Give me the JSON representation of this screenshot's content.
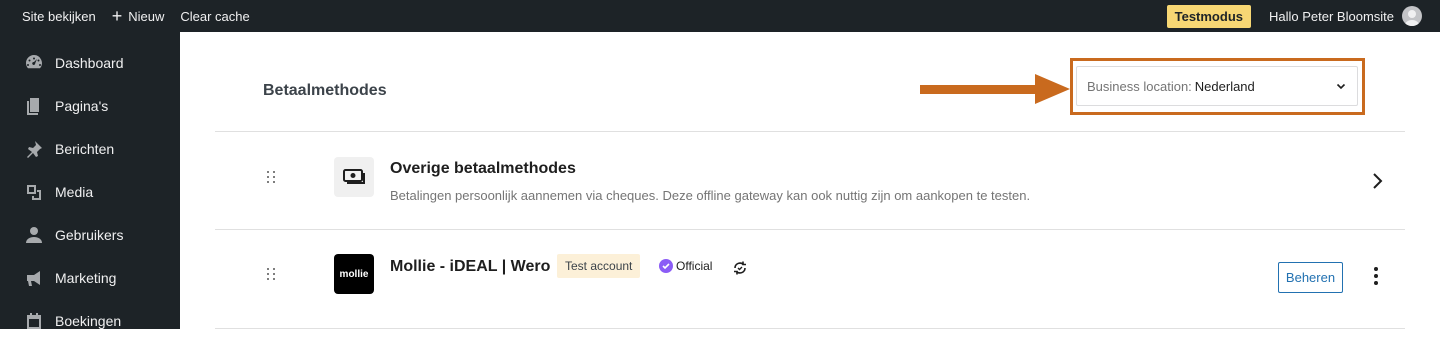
{
  "adminbar": {
    "site_link": "Site bekijken",
    "new_label": "Nieuw",
    "clear_cache": "Clear cache",
    "test_mode": "Testmodus",
    "greeting": "Hallo Peter Bloomsite"
  },
  "sidebar": {
    "items": [
      {
        "label": "Dashboard",
        "icon": "dashboard-icon"
      },
      {
        "label": "Pagina's",
        "icon": "pages-icon"
      },
      {
        "label": "Berichten",
        "icon": "pin-icon"
      },
      {
        "label": "Media",
        "icon": "media-icon"
      },
      {
        "label": "Gebruikers",
        "icon": "user-icon"
      },
      {
        "label": "Marketing",
        "icon": "megaphone-icon"
      },
      {
        "label": "Boekingen",
        "icon": "calendar-icon"
      }
    ]
  },
  "main": {
    "title": "Betaalmethodes",
    "location": {
      "label": "Business location:",
      "value": "Nederland"
    },
    "methods": [
      {
        "title": "Overige betaalmethodes",
        "description": "Betalingen persoonlijk aannemen via cheques. Deze offline gateway kan ook nuttig zijn om aankopen te testen."
      },
      {
        "title": "Mollie - iDEAL | Wero",
        "logo_text": "mollie",
        "badge": "Test account",
        "official": "Official",
        "manage_label": "Beheren"
      }
    ]
  },
  "colors": {
    "adminbar_bg": "#1d2327",
    "test_mode_bg": "#f7d774",
    "annotation_orange": "#c96a1e",
    "link_blue": "#2271b1",
    "official_purple": "#8b5cf6"
  }
}
